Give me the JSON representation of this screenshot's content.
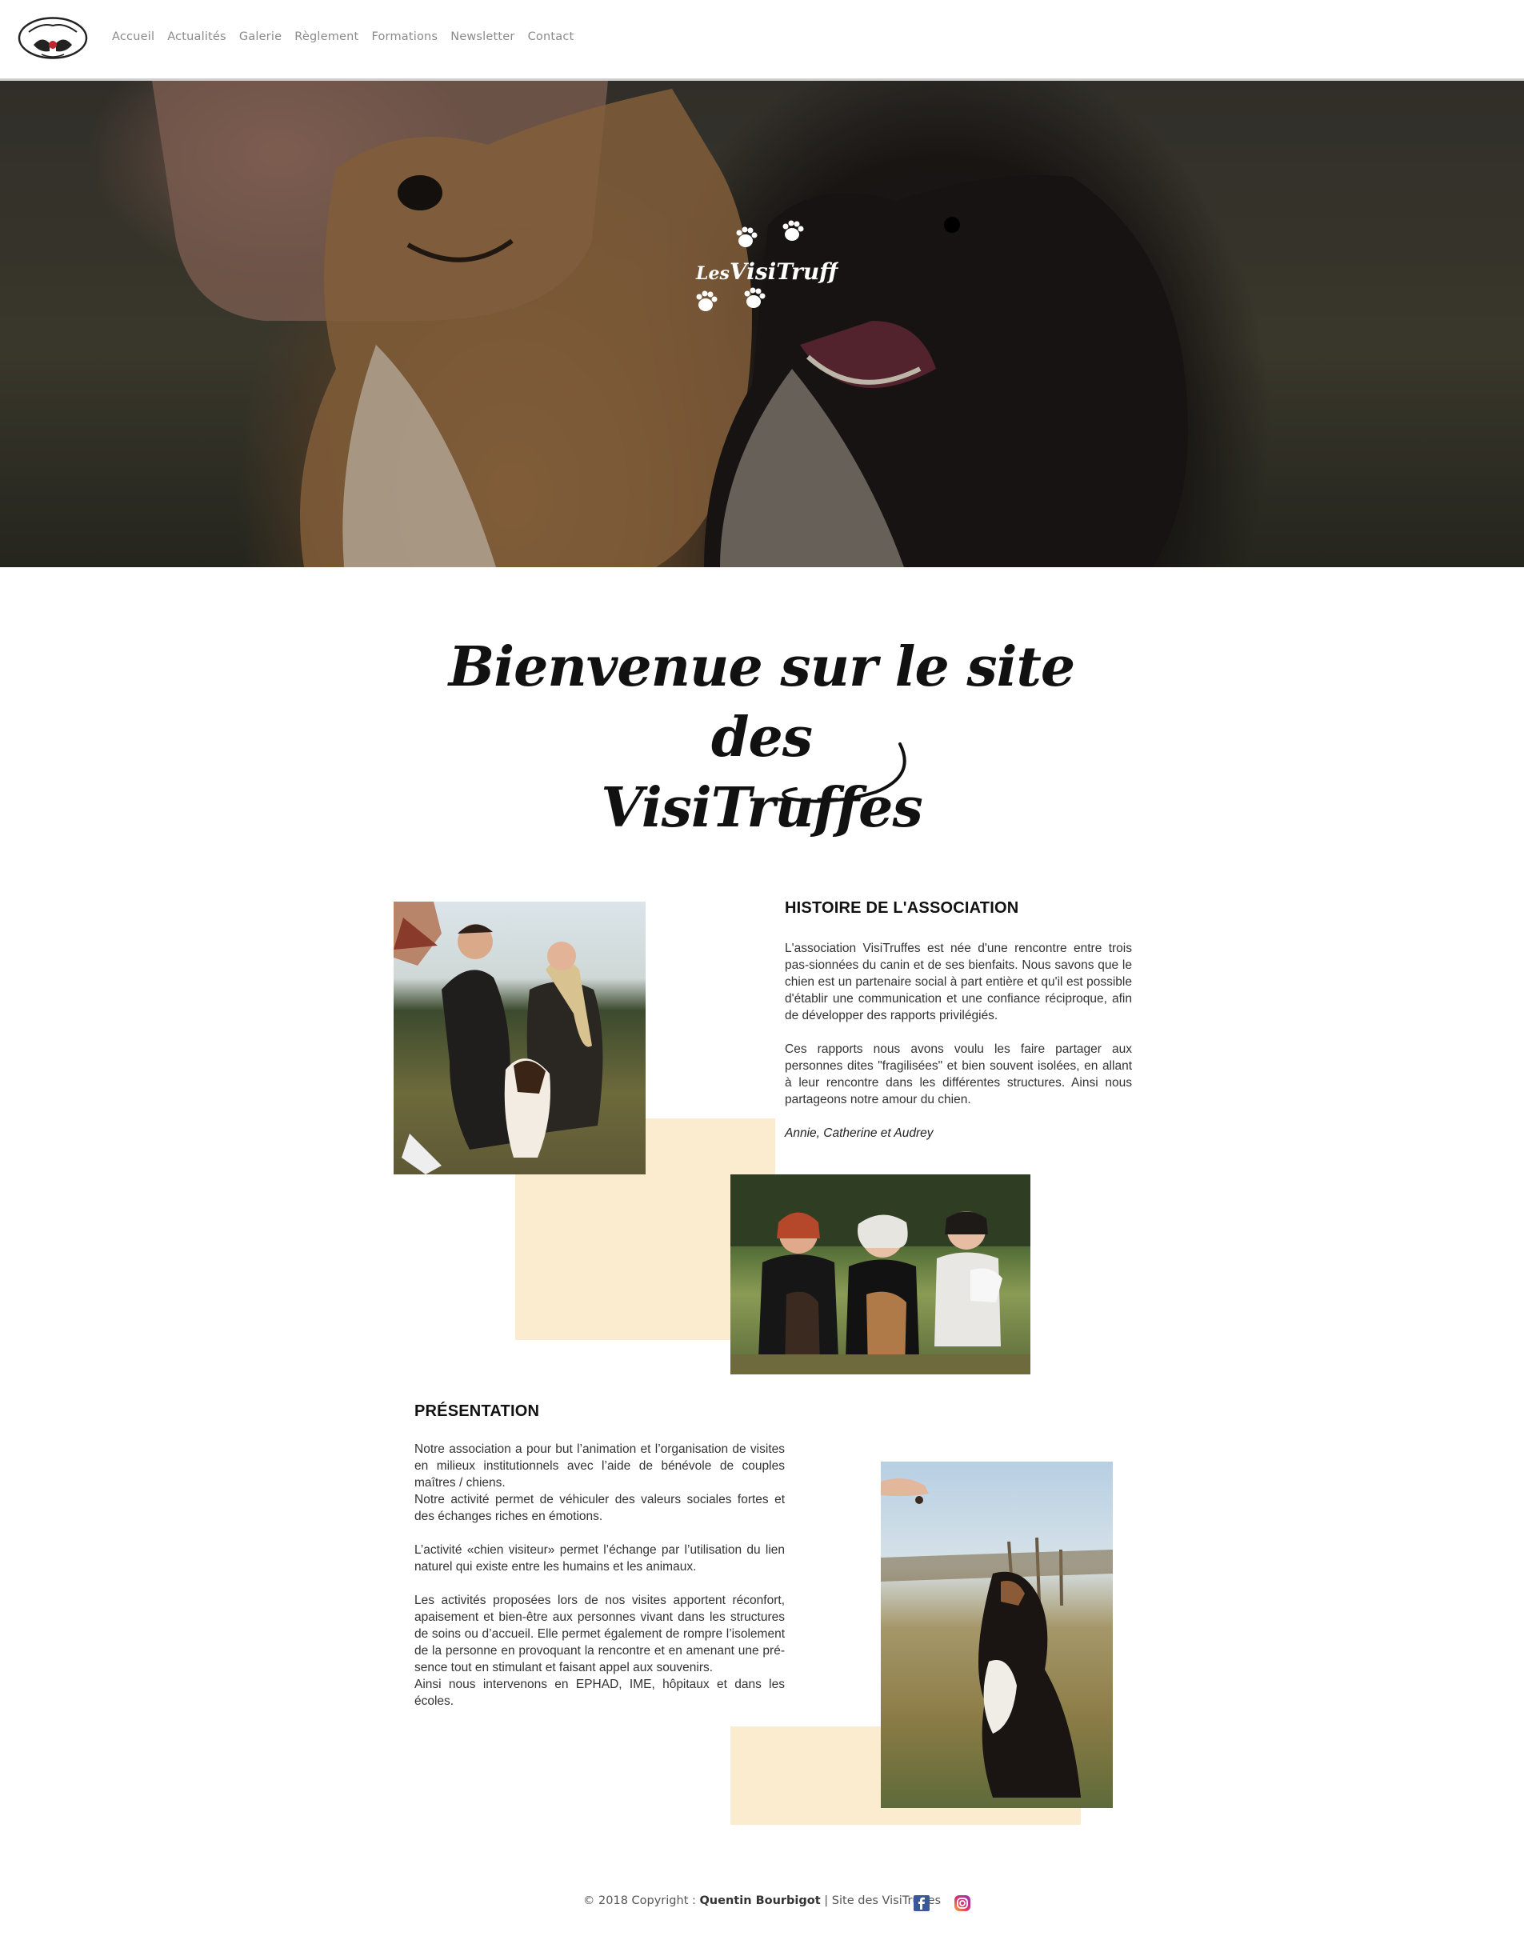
{
  "nav": {
    "logo_icon": "visitruffes-logo-icon",
    "items": [
      "Accueil",
      "Actualités",
      "Galerie",
      "Règlement",
      "Formations",
      "Newsletter",
      "Contact"
    ]
  },
  "hero": {
    "logo_text_1": "Les",
    "logo_text_2": "VisiTruffes",
    "logo_icon": "paw-prints-icon"
  },
  "welcome": {
    "line1": "Bienvenue sur le site des",
    "line2": "VisiTruffes"
  },
  "histoire": {
    "title": "HISTOIRE DE L'ASSOCIATION",
    "p1": "L'association VisiTruffes est née d'une rencontre entre trois pas-sionnées du canin et de ses bienfaits. Nous savons que le chien est un partenaire social à part entière et qu'il est possible d'établir une communication et une confiance réciproque, afin de développer des rapports privilégiés.",
    "p2": "Ces rapports nous avons voulu les faire partager aux personnes dites \"fragilisées\" et bien souvent isolées, en allant à leur rencontre dans les différentes structures. Ainsi nous partageons notre amour du chien.",
    "signature": "Annie, Catherine et Audrey"
  },
  "presentation": {
    "title": "PRÉSENTATION",
    "p1": "Notre association a pour but l’animation et l’organisation de visites en milieux institutionnels avec l’aide de bénévole de couples maîtres / chiens.",
    "p1b": "Notre activité permet de véhiculer des valeurs sociales fortes et des échanges riches en émotions.",
    "p2": "L’activité «chien visiteur» permet l’échange par l’utilisation du lien naturel qui existe entre les humains et les animaux.",
    "p3": "Les activités proposées lors de nos visites apportent réconfort, apaisement et bien-être aux personnes vivant dans les structures de soins ou d’accueil. Elle permet également de rompre l’isolement de la personne en provoquant la rencontre et en amenant une pré-sence tout en stimulant et faisant appel aux souvenirs.",
    "p3b": "Ainsi nous intervenons en EPHAD, IME, hôpitaux et dans les écoles."
  },
  "footer": {
    "prefix": "© 2018 Copyright : ",
    "author": "Quentin Bourbigot",
    "suffix": " | Site des VisiTruffes",
    "facebook_icon": "facebook-icon",
    "instagram_icon": "instagram-icon"
  },
  "colors": {
    "accent_cream": "#fbebcf",
    "nav_text": "#8a8a8a",
    "facebook": "#3b5998"
  }
}
